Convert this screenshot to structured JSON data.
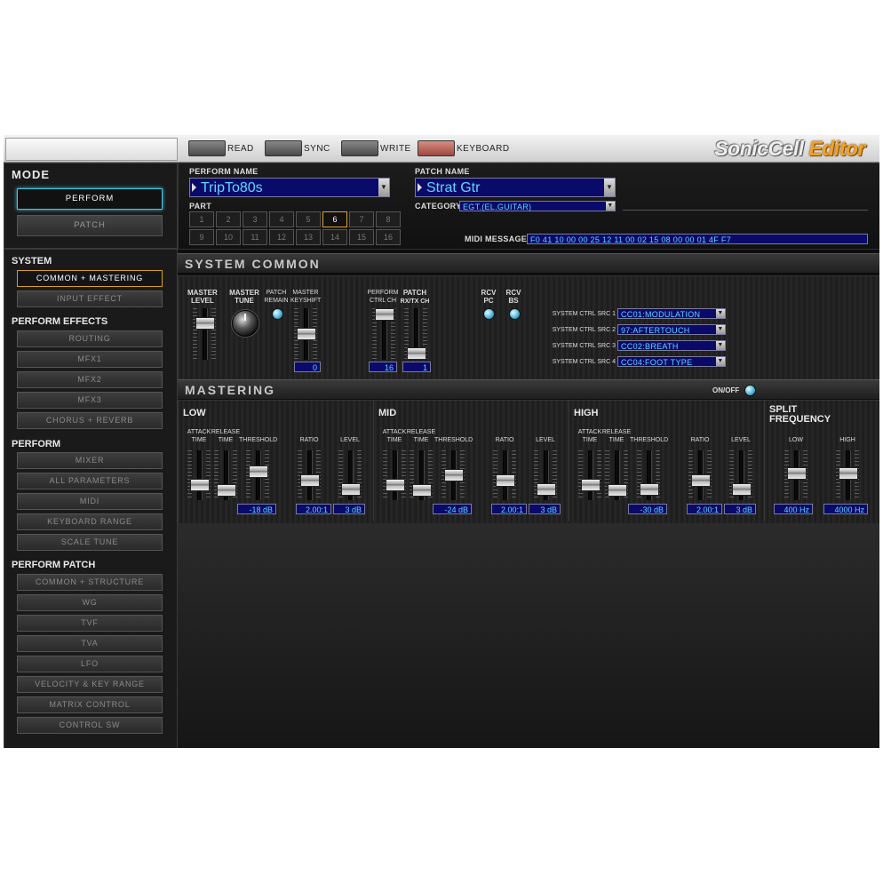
{
  "toolbar": {
    "read": "READ",
    "sync": "SYNC",
    "write": "WRITE",
    "keyboard": "KEYBOARD",
    "logo_main": "SonicCell",
    "logo_suffix": "Editor"
  },
  "mode": {
    "title": "MODE",
    "perform": "PERFORM",
    "patch": "PATCH"
  },
  "nav": {
    "system": {
      "title": "SYSTEM",
      "items": [
        "COMMON + MASTERING",
        "INPUT EFFECT"
      ]
    },
    "perform_effects": {
      "title": "PERFORM EFFECTS",
      "items": [
        "ROUTING",
        "MFX1",
        "MFX2",
        "MFX3",
        "CHORUS + REVERB"
      ]
    },
    "perform": {
      "title": "PERFORM",
      "items": [
        "MIXER",
        "ALL PARAMETERS",
        "MIDI",
        "KEYBOARD RANGE",
        "SCALE TUNE"
      ]
    },
    "perform_patch": {
      "title": "PERFORM PATCH",
      "items": [
        "COMMON + STRUCTURE",
        "WG",
        "TVF",
        "TVA",
        "LFO",
        "VELOCITY & KEY RANGE",
        "MATRIX CONTROL",
        "CONTROL SW"
      ]
    }
  },
  "info": {
    "perform_name_label": "PERFORM NAME",
    "perform_name": "TripTo80s",
    "patch_name_label": "PATCH  NAME",
    "patch_name": "Strat Gtr",
    "category_label": "CATEGORY",
    "category": "EGT.(EL.GUITAR)",
    "part_label": "PART",
    "parts": [
      "1",
      "2",
      "3",
      "4",
      "5",
      "6",
      "7",
      "8",
      "9",
      "10",
      "11",
      "12",
      "13",
      "14",
      "15",
      "16"
    ],
    "selected_part": "6",
    "midi_message_label": "MIDI MESSAGE",
    "midi_message": "F0 41 10 00 00 25 12 11 00 02 15 08 00 00 01 4F F7"
  },
  "system_common": {
    "title": "SYSTEM COMMON",
    "master_level": {
      "label1": "MASTER",
      "label2": "LEVEL",
      "level": 0.78
    },
    "master_tune": {
      "label1": "MASTER",
      "label2": "TUNE"
    },
    "patch_remain": {
      "label1": "PATCH",
      "label2": "REMAIN"
    },
    "master_keyshift": {
      "label1": "MASTER",
      "label2": "KEYSHIFT",
      "value": "0",
      "level": 0.5
    },
    "perform_ctrl_ch": {
      "label1": "PERFORM",
      "label2": "CTRL CH",
      "value": "16",
      "level": 1.0
    },
    "patch_rxtx_ch": {
      "label1": "PATCH",
      "label2": "RX/TX CH",
      "value": "1",
      "level": 0.0
    },
    "rcv_pc": {
      "label1": "RCV",
      "label2": "PC"
    },
    "rcv_bs": {
      "label1": "RCV",
      "label2": "BS"
    },
    "ctrl_src": [
      {
        "label": "SYSTEM CTRL SRC  1",
        "value": "CC01:MODULATION"
      },
      {
        "label": "SYSTEM CTRL SRC  2",
        "value": "97:AFTERTOUCH"
      },
      {
        "label": "SYSTEM CTRL SRC  3",
        "value": "CC02:BREATH"
      },
      {
        "label": "SYSTEM CTRL SRC  4",
        "value": "CC04:FOOT TYPE"
      }
    ]
  },
  "mastering": {
    "title": "MASTERING",
    "onoff": "ON/OFF",
    "param_labels": {
      "attack1": "ATTACK",
      "attack2": "TIME",
      "release1": "RELEASE",
      "release2": "TIME",
      "threshold": "THRESHOLD",
      "ratio": "RATIO",
      "level": "LEVEL"
    },
    "bands": [
      {
        "name": "LOW",
        "threshold": "-18 dB",
        "ratio": "2.00:1",
        "level": "3 dB",
        "levels": [
          0.25,
          0.1,
          0.6,
          0.35,
          0.12
        ]
      },
      {
        "name": "MID",
        "threshold": "-24 dB",
        "ratio": "2.00:1",
        "level": "3 dB",
        "levels": [
          0.25,
          0.1,
          0.5,
          0.35,
          0.12
        ]
      },
      {
        "name": "HIGH",
        "threshold": "-30 dB",
        "ratio": "2.00:1",
        "level": "3 dB",
        "levels": [
          0.25,
          0.1,
          0.12,
          0.35,
          0.12
        ]
      }
    ],
    "split": {
      "title1": "SPLIT",
      "title2": "FREQUENCY",
      "low_label": "LOW",
      "high_label": "HIGH",
      "low": "400 Hz",
      "high": "4000 Hz",
      "levels": [
        0.55,
        0.55
      ]
    }
  }
}
